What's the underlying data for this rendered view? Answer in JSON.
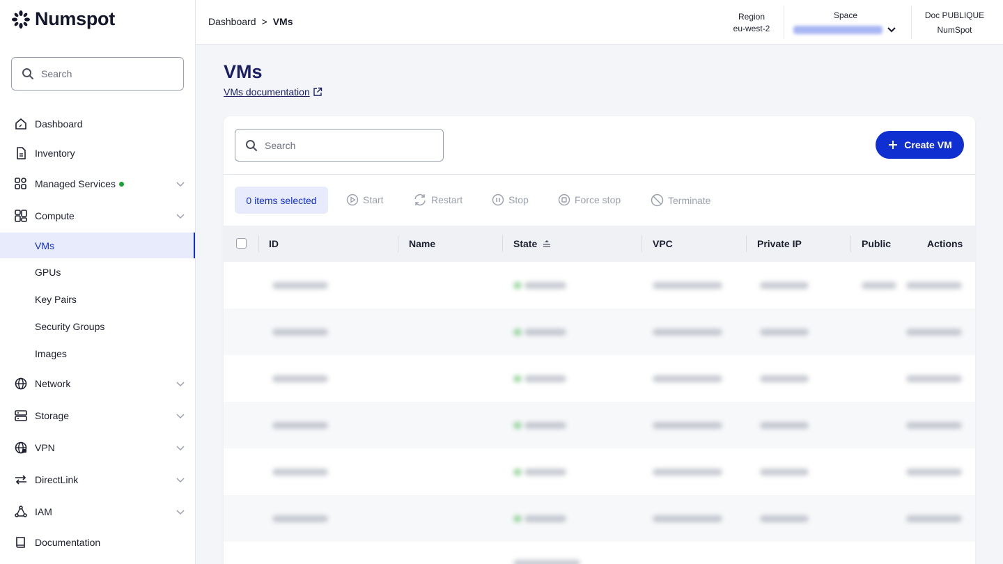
{
  "brand": {
    "name": "Numspot"
  },
  "sidebar": {
    "search_placeholder": "Search",
    "items": [
      {
        "label": "Dashboard",
        "icon": "home-icon"
      },
      {
        "label": "Inventory",
        "icon": "document-icon"
      },
      {
        "label": "Managed Services",
        "icon": "services-icon",
        "status_dot": "#1aa335"
      },
      {
        "label": "Compute",
        "icon": "grid-icon"
      },
      {
        "label": "Network",
        "icon": "globe-icon"
      },
      {
        "label": "Storage",
        "icon": "storage-icon"
      },
      {
        "label": "VPN",
        "icon": "vpn-globe-icon"
      },
      {
        "label": "DirectLink",
        "icon": "directlink-icon"
      },
      {
        "label": "IAM",
        "icon": "iam-icon"
      },
      {
        "label": "Documentation",
        "icon": "book-icon"
      }
    ],
    "compute_sub": [
      {
        "label": "VMs",
        "active": true
      },
      {
        "label": "GPUs"
      },
      {
        "label": "Key Pairs"
      },
      {
        "label": "Security Groups"
      },
      {
        "label": "Images"
      }
    ]
  },
  "topbar": {
    "breadcrumb": {
      "root": "Dashboard",
      "separator": ">",
      "current": "VMs"
    },
    "region": {
      "label": "Region",
      "value": "eu-west-2"
    },
    "space": {
      "label": "Space"
    },
    "org": {
      "label": "Doc PUBLIQUE",
      "value": "NumSpot"
    }
  },
  "page": {
    "title": "VMs",
    "doc_link": "VMs documentation"
  },
  "toolbar": {
    "search_placeholder": "Search",
    "create_label": "Create VM",
    "selected_label": "0 items selected",
    "actions": [
      "Start",
      "Restart",
      "Stop",
      "Force stop",
      "Terminate"
    ]
  },
  "table": {
    "columns": [
      "ID",
      "Name",
      "State",
      "VPC",
      "Private IP",
      "Public",
      "Actions"
    ]
  },
  "colors": {
    "accent": "#0f2fd1",
    "title": "#1a1f63",
    "status_green": "#1aa335"
  }
}
